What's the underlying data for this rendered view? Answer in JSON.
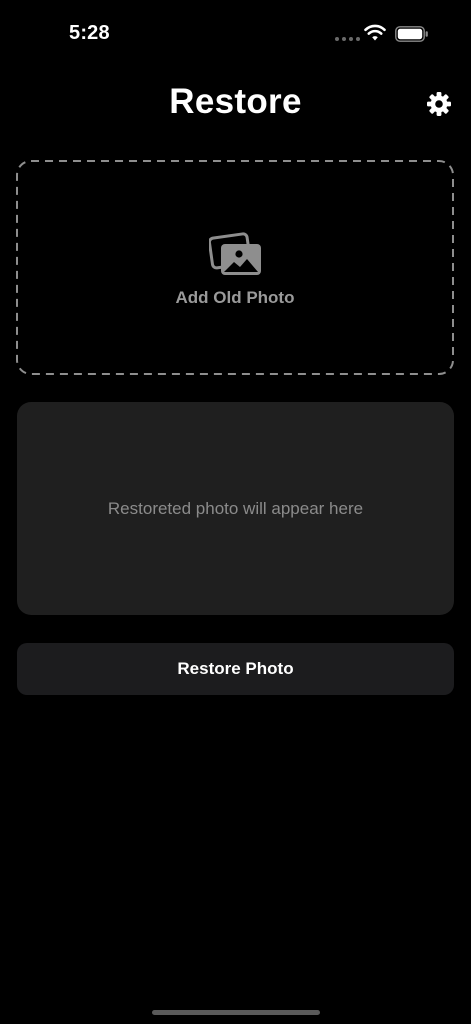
{
  "status_bar": {
    "time": "5:28",
    "icons": [
      "signal-dots-icon",
      "wifi-icon",
      "battery-icon"
    ]
  },
  "header": {
    "title": "Restore",
    "settings_icon": "gear-icon"
  },
  "add_photo": {
    "label": "Add Old Photo",
    "icon": "photos-icon"
  },
  "result": {
    "placeholder": "Restoreted photo will appear here"
  },
  "actions": {
    "restore_label": "Restore Photo"
  },
  "colors": {
    "background": "#000000",
    "panel": "#1f1f1f",
    "button": "#1c1c1e",
    "muted_text": "#8b8b8b",
    "dashed_border": "#8e8e8e"
  }
}
